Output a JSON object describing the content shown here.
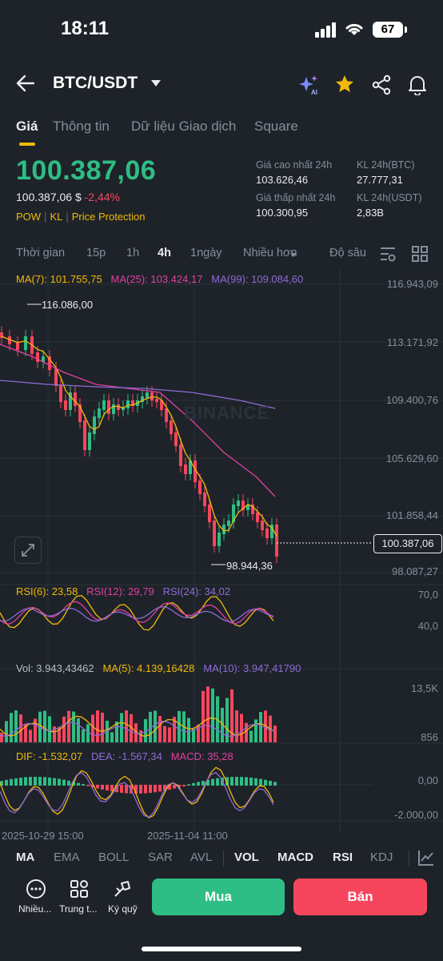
{
  "status_bar": {
    "time": "18:11",
    "battery": "67",
    "battery_color": "#ffffff"
  },
  "header": {
    "pair": "BTC/USDT",
    "icons": [
      "back-arrow-icon",
      "dropdown-caret-icon",
      "ai-sparkle-icon",
      "star-icon",
      "share-icon",
      "bell-icon"
    ],
    "ai_label": "AI",
    "star_color": "#f0b90b"
  },
  "tabs": [
    "Giá",
    "Thông tin",
    "Dữ liệu Giao dịch",
    "Square"
  ],
  "price": {
    "last": "100.387,06",
    "usd": "100.387,06 $",
    "change": "-2,44%",
    "tags": [
      "POW",
      "KL",
      "Price Protection"
    ]
  },
  "stats": {
    "high_label": "Giá cao nhất 24h",
    "high_value": "103.626,46",
    "low_label": "Giá thấp nhất 24h",
    "low_value": "100.300,95",
    "vol_btc_label": "KL 24h(BTC)",
    "vol_btc_value": "27.777,31",
    "vol_usdt_label": "KL 24h(USDT)",
    "vol_usdt_value": "2,83B"
  },
  "intervals": [
    "Thời gian",
    "15p",
    "1h",
    "4h",
    "1ngày",
    "Nhiều hơn",
    "Độ sâu"
  ],
  "active_interval": "4h",
  "ma_legend": {
    "ma7": "MA(7): 101.755,75",
    "ma25": "MA(25): 103.424,17",
    "ma99": "MA(99): 109.084,60"
  },
  "price_axis": [
    "116.943,09",
    "113.171,92",
    "109.400,76",
    "105.629,60",
    "101.858,44",
    "98.087,27"
  ],
  "current_price_tag": "100.387,06",
  "high_marker": "116.086,00",
  "low_marker": "98.944,36",
  "watermark": "BINANCE",
  "rsi": {
    "rsi6": "RSI(6): 23,58",
    "rsi12": "RSI(12): 29,79",
    "rsi24": "RSI(24): 34,02",
    "axis": [
      "70,0",
      "40,0"
    ]
  },
  "volume": {
    "vol": "Vol: 3.943,43462",
    "ma5": "MA(5): 4.139,16428",
    "ma10": "MA(10): 3.947,41790",
    "axis": [
      "13,5K",
      "856"
    ]
  },
  "macd": {
    "dif": "DIF: -1.532,07",
    "dea": "DEA: -1.567,34",
    "macd": "MACD: 35,28",
    "axis": [
      "0,00",
      "-2.000,00"
    ]
  },
  "time_axis": [
    "2025-10-29 15:00",
    "2025-11-04 11:00"
  ],
  "indicator_tabs": [
    "MA",
    "EMA",
    "BOLL",
    "SAR",
    "AVL",
    "VOL",
    "MACD",
    "RSI",
    "KDJ"
  ],
  "active_indicators": [
    "MA",
    "VOL",
    "MACD",
    "RSI"
  ],
  "action_bar": {
    "more_label": "Nhiều...",
    "trading_label": "Trung t...",
    "margin_label": "Ký quỹ",
    "buy": "Mua",
    "sell": "Bán"
  },
  "colors": {
    "up": "#2ebd85",
    "down": "#f6465d",
    "ma7": "#f0b90b",
    "ma25": "#e040a0",
    "ma99": "#8e6bd6",
    "accent": "#f0b90b",
    "bg": "#1e2329"
  }
}
